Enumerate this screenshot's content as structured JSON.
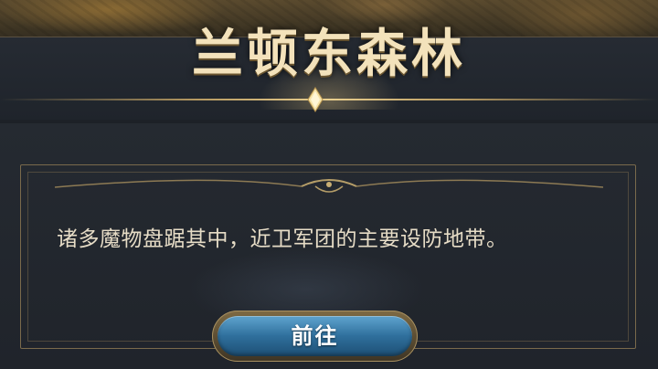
{
  "location": {
    "title": "兰顿东森林",
    "description": "诸多魔物盘踞其中，近卫军团的主要设防地带。"
  },
  "actions": {
    "go_label": "前往"
  },
  "colors": {
    "title_gold": "#f3e2bb",
    "frame_gold": "#7a6a4c",
    "button_blue": "#2f6f9c",
    "panel_bg": "#20242b"
  },
  "icons": {
    "title_gem": "diamond-gem-icon"
  }
}
